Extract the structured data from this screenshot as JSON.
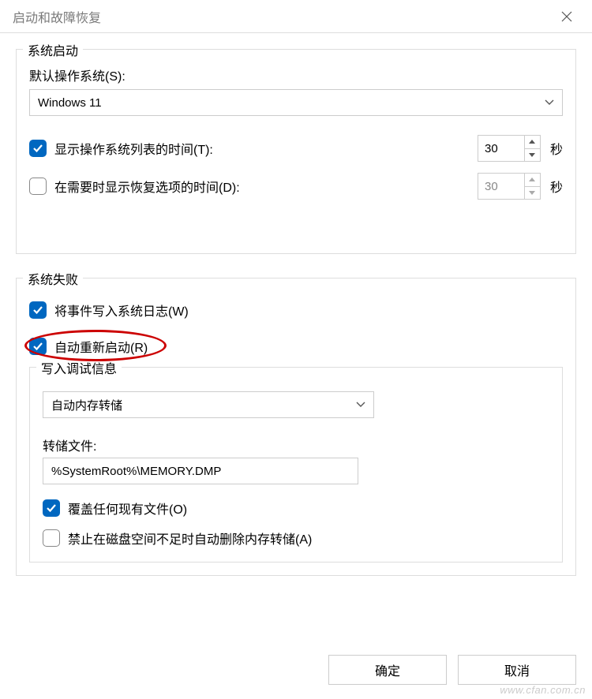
{
  "window": {
    "title": "启动和故障恢复"
  },
  "system_startup": {
    "group_label": "系统启动",
    "default_os_label": "默认操作系统(S):",
    "default_os_value": "Windows 11",
    "show_os_list": {
      "checked": true,
      "label": "显示操作系统列表的时间(T):",
      "value": "30",
      "unit": "秒"
    },
    "show_recovery": {
      "checked": false,
      "label": "在需要时显示恢复选项的时间(D):",
      "value": "30",
      "unit": "秒"
    }
  },
  "system_failure": {
    "group_label": "系统失败",
    "write_event_log": {
      "checked": true,
      "label": "将事件写入系统日志(W)"
    },
    "auto_restart": {
      "checked": true,
      "label": "自动重新启动(R)"
    },
    "debug_info": {
      "group_label": "写入调试信息",
      "dump_type": "自动内存转储",
      "dump_file_label": "转储文件:",
      "dump_file_value": "%SystemRoot%\\MEMORY.DMP",
      "overwrite": {
        "checked": true,
        "label": "覆盖任何现有文件(O)"
      },
      "disable_auto_delete": {
        "checked": false,
        "label": "禁止在磁盘空间不足时自动删除内存转储(A)"
      }
    }
  },
  "buttons": {
    "ok": "确定",
    "cancel": "取消"
  },
  "watermark": "www.cfan.com.cn"
}
